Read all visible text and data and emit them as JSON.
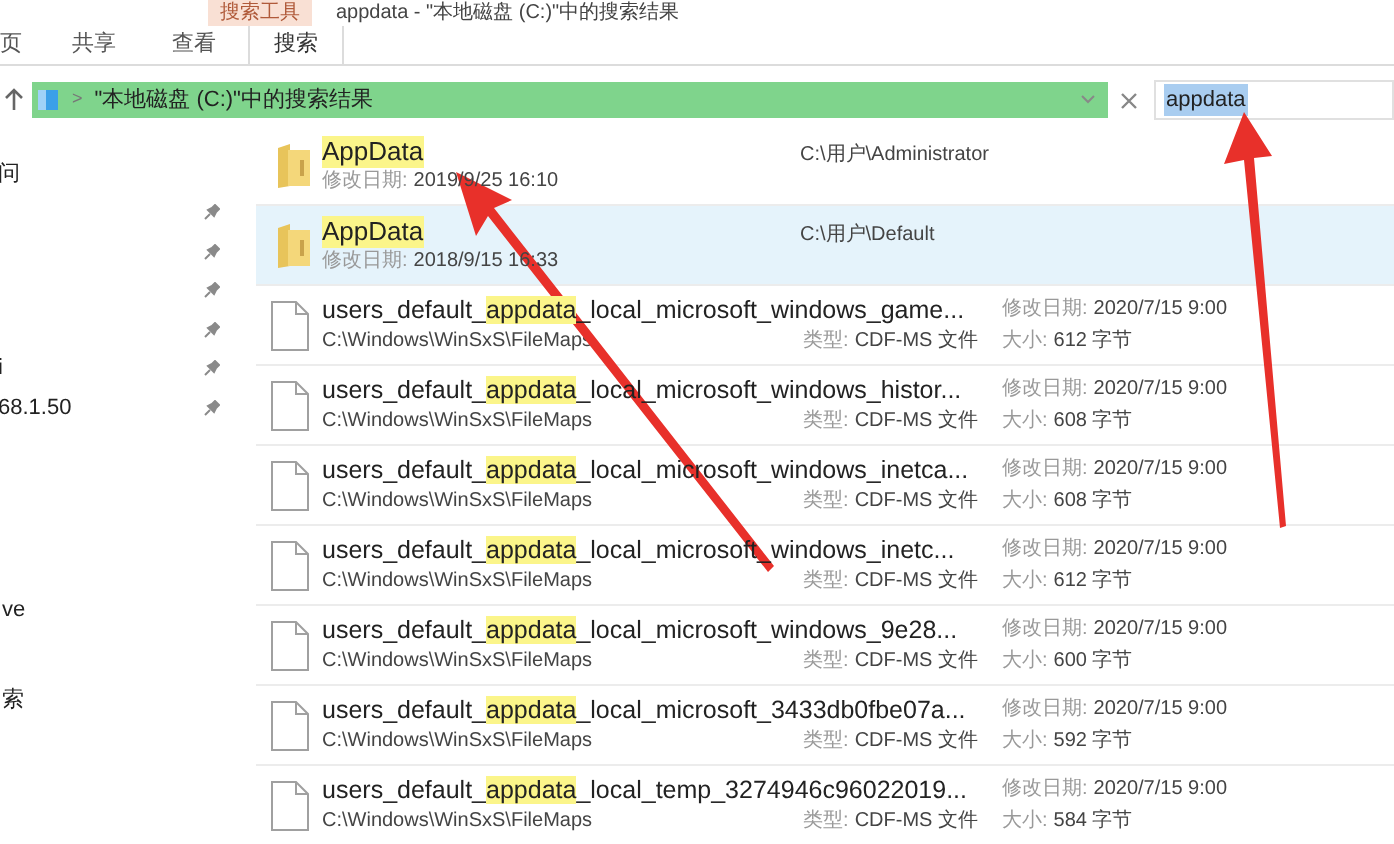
{
  "title_bar": {
    "context_tab": "搜索工具",
    "title": "appdata - \"本地磁盘 (C:)\"中的搜索结果"
  },
  "ribbon_tabs": [
    {
      "label": "页",
      "selected": false
    },
    {
      "label": "共享",
      "selected": false
    },
    {
      "label": "查看",
      "selected": false
    },
    {
      "label": "搜索",
      "selected": true
    }
  ],
  "address_bar": {
    "separator": ">",
    "location": "\"本地磁盘 (C:)\"中的搜索结果"
  },
  "search_box": {
    "value": "appdata",
    "text_selected": true
  },
  "nav_pane": {
    "quick_access": [
      {
        "label": "问",
        "pinned": false
      },
      {
        "pinned": true
      },
      {
        "pinned": true
      },
      {
        "pinned": true
      },
      {
        "pinned": true
      },
      {
        "label": "i",
        "pinned": true
      },
      {
        "label": "68.1.50",
        "pinned": true
      }
    ],
    "other_items": [
      {
        "label": "ve"
      },
      {
        "label": "索"
      }
    ]
  },
  "folders": [
    {
      "name": "AppData",
      "date_label": "修改日期:",
      "date": "2019/9/25 16:10",
      "path": "C:\\用户\\Administrator",
      "selected": false
    },
    {
      "name": "AppData",
      "date_label": "修改日期:",
      "date": "2018/9/15 16:33",
      "path": "C:\\用户\\Default",
      "selected": true
    }
  ],
  "files": [
    {
      "prefix": "users_default_",
      "match": "appdata",
      "suffix": "_local_microsoft_windows_game...",
      "path": "C:\\Windows\\WinSxS\\FileMaps",
      "type_label": "类型:",
      "type": "CDF-MS 文件",
      "date_label": "修改日期:",
      "date": "2020/7/15 9:00",
      "size_label": "大小:",
      "size": "612 字节"
    },
    {
      "prefix": "users_default_",
      "match": "appdata",
      "suffix": "_local_microsoft_windows_histor...",
      "path": "C:\\Windows\\WinSxS\\FileMaps",
      "type_label": "类型:",
      "type": "CDF-MS 文件",
      "date_label": "修改日期:",
      "date": "2020/7/15 9:00",
      "size_label": "大小:",
      "size": "608 字节"
    },
    {
      "prefix": "users_default_",
      "match": "appdata",
      "suffix": "_local_microsoft_windows_inetca...",
      "path": "C:\\Windows\\WinSxS\\FileMaps",
      "type_label": "类型:",
      "type": "CDF-MS 文件",
      "date_label": "修改日期:",
      "date": "2020/7/15 9:00",
      "size_label": "大小:",
      "size": "608 字节"
    },
    {
      "prefix": "users_default_",
      "match": "appdata",
      "suffix": "_local_microsoft_windows_inetc...",
      "path": "C:\\Windows\\WinSxS\\FileMaps",
      "type_label": "类型:",
      "type": "CDF-MS 文件",
      "date_label": "修改日期:",
      "date": "2020/7/15 9:00",
      "size_label": "大小:",
      "size": "612 字节"
    },
    {
      "prefix": "users_default_",
      "match": "appdata",
      "suffix": "_local_microsoft_windows_9e28...",
      "path": "C:\\Windows\\WinSxS\\FileMaps",
      "type_label": "类型:",
      "type": "CDF-MS 文件",
      "date_label": "修改日期:",
      "date": "2020/7/15 9:00",
      "size_label": "大小:",
      "size": "600 字节"
    },
    {
      "prefix": "users_default_",
      "match": "appdata",
      "suffix": "_local_microsoft_3433db0fbe07a...",
      "path": "C:\\Windows\\WinSxS\\FileMaps",
      "type_label": "类型:",
      "type": "CDF-MS 文件",
      "date_label": "修改日期:",
      "date": "2020/7/15 9:00",
      "size_label": "大小:",
      "size": "592 字节"
    },
    {
      "prefix": "users_default_",
      "match": "appdata",
      "suffix": "_local_temp_3274946c96022019...",
      "path": "C:\\Windows\\WinSxS\\FileMaps",
      "type_label": "类型:",
      "type": "CDF-MS 文件",
      "date_label": "修改日期:",
      "date": "2020/7/15 9:00",
      "size_label": "大小:",
      "size": "584 字节"
    }
  ]
}
